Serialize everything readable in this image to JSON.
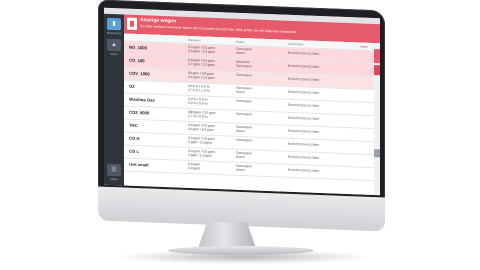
{
  "alert": {
    "title": "Anzeige wegen",
    "message": "Ein oder mehrere Parameter haben den Grenzwert überschritten. Bitte prüfen Sie die folgenden Messwerte."
  },
  "table": {
    "headers": [
      "Messwert",
      "Status",
      "Zeitstempel",
      "Alarm"
    ],
    "rows": [
      {
        "name": "NO_1000",
        "value": "3.3 ppm / 0.0 ppm\n3.3 ppm / 1.0 ppm",
        "state": "Gemessen\nAlarm",
        "time": "Erreicht (Grenz) Wert",
        "style": "alarm"
      },
      {
        "name": "CO_100",
        "value": "0.0 ppm / 0.0 ppm\n3.7 ppm / 1.5 ppm",
        "state": "Überhöht\nGemessen",
        "time": "Erreicht (Grenz) Wert",
        "style": "alarm"
      },
      {
        "name": "COV_1000",
        "value": "50 ppm / 0.8 ppm\n4.2 ppm / 1.9 ppm",
        "state": "Gemessen",
        "time": "Erreicht (Grenz) Wert",
        "style": "warn"
      },
      {
        "name": "O2",
        "value": "20.9 % / 0.0 %\n17.3 % / 1.0 %",
        "state": "Gemessen\nAlarm",
        "time": "Erreicht (Grenz) Wert",
        "style": ""
      },
      {
        "name": "Mischna Gas",
        "value": "0.0 % / 0.0 %\n5.0 % / 0.0 %",
        "state": "Gemessen",
        "time": "Erreicht (Grenz) Wert",
        "style": ""
      },
      {
        "name": "CO2_5000",
        "value": "300 ppm / 0.0 ppm\n1.7 % / 0.6 %",
        "state": "Gemessen",
        "time": "Erreicht (Grenz) Wert",
        "style": ""
      },
      {
        "name": "THC",
        "value": "0.0 ppm / 0.0 ppm\n10 ppm / 5.0 ppm",
        "state": "Gemessen\nAlarm",
        "time": "Erreicht (Grenz) Wert",
        "style": ""
      },
      {
        "name": "CO H",
        "value": "0.0 ppm / 0.0 ppm\n6 ppm / 2.0 ppm",
        "state": "Gemessen",
        "time": "Erreicht (Grenz) Wert",
        "style": ""
      },
      {
        "name": "CO L",
        "value": "0.0 ppm / 0.0 ppm\n3 ppm / 1.0 ppm",
        "state": "Gemessen\nAlarm",
        "time": "Erreicht (Grenz) Wert",
        "style": ""
      },
      {
        "name": "rest small",
        "value": "0.0 ppm\n0.0 ppm",
        "state": "Gemessen\nAlarm",
        "time": "Erreicht (Grenz) Wert",
        "style": ""
      }
    ]
  },
  "sidebar": {
    "items": [
      {
        "label": "Messwerte",
        "icon": "bars-icon"
      },
      {
        "label": "Alarm",
        "icon": "bell-icon"
      }
    ],
    "bottom_label": "Menü"
  }
}
